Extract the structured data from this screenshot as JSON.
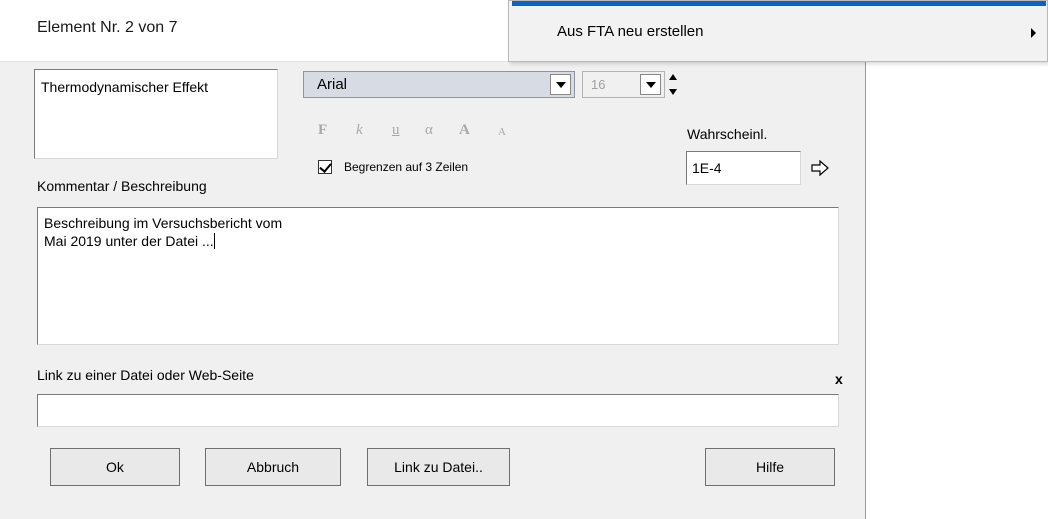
{
  "dialog": {
    "title": "Element Nr. 2 von 7",
    "name_text": "Thermodynamischer Effekt",
    "font": {
      "family_value": "Arial",
      "size_value": "16"
    },
    "format_buttons": [
      "F",
      "k",
      "u",
      "α",
      "A",
      "A"
    ],
    "limit_checkbox": {
      "label": "Begrenzen auf 3 Zeilen",
      "checked": true
    },
    "probability": {
      "label": "Wahrscheinl.",
      "value": "1E-4",
      "arrow_icon": "right-arrow-icon"
    },
    "comment": {
      "label": "Kommentar / Beschreibung",
      "line1": "Beschreibung im Versuchsbericht vom",
      "line2": "Mai 2019 unter der Datei ..."
    },
    "link": {
      "label": "Link zu einer Datei oder Web-Seite",
      "clear": "x",
      "value": ""
    },
    "buttons": {
      "ok": "Ok",
      "cancel": "Abbruch",
      "link_file": "Link zu Datei..",
      "help": "Hilfe"
    }
  },
  "context_menu": {
    "items": [
      {
        "label": "Aus FTA neu erstellen",
        "has_submenu": true
      }
    ]
  }
}
